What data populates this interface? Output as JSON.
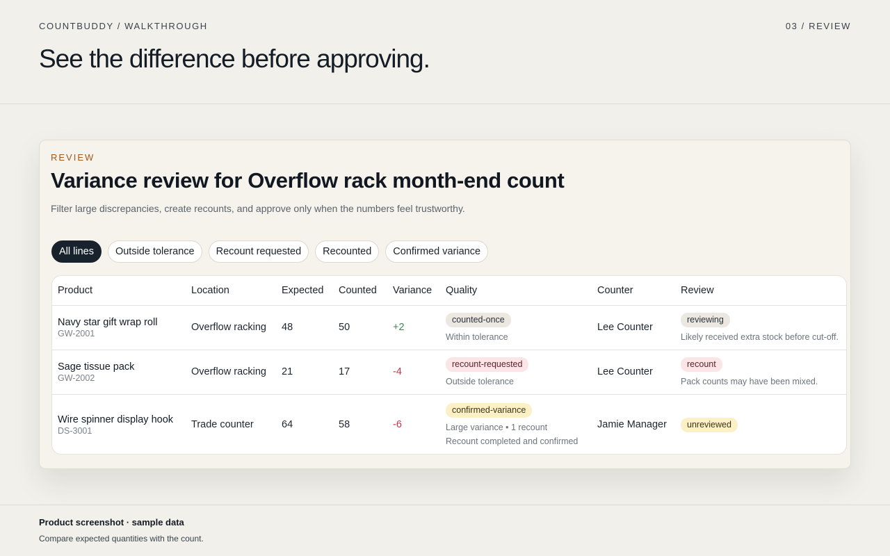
{
  "header": {
    "brand": "COUNTBUDDY / WALKTHROUGH",
    "step": "03 / REVIEW",
    "headline": "See the difference before approving."
  },
  "card": {
    "eyebrow": "REVIEW",
    "title": "Variance review for Overflow rack month-end count",
    "subtitle": "Filter large discrepancies, create recounts, and approve only when the numbers feel trustworthy."
  },
  "filters": [
    "All lines",
    "Outside tolerance",
    "Recount requested",
    "Recounted",
    "Confirmed variance"
  ],
  "table": {
    "columns": [
      "Product",
      "Location",
      "Expected",
      "Counted",
      "Variance",
      "Quality",
      "Counter",
      "Review"
    ],
    "rows": [
      {
        "product": "Navy star gift wrap roll",
        "sku": "GW-2001",
        "location": "Overflow racking",
        "expected": "48",
        "counted": "50",
        "variance": "+2",
        "quality_badge": "counted-once",
        "quality_note": "Within tolerance",
        "counter": "Lee Counter",
        "review_badge": "reviewing",
        "review_note": "Likely received extra stock before cut-off."
      },
      {
        "product": "Sage tissue pack",
        "sku": "GW-2002",
        "location": "Overflow racking",
        "expected": "21",
        "counted": "17",
        "variance": "-4",
        "quality_badge": "recount-requested",
        "quality_note": "Outside tolerance",
        "counter": "Lee Counter",
        "review_badge": "recount",
        "review_note": "Pack counts may have been mixed."
      },
      {
        "product": "Wire spinner display hook",
        "sku": "DS-3001",
        "location": "Trade counter",
        "expected": "64",
        "counted": "58",
        "variance": "-6",
        "quality_badge": "confirmed-variance",
        "quality_note": "Large variance • 1 recount",
        "quality_note2": "Recount completed and confirmed",
        "counter": "Jamie Manager",
        "review_badge": "unreviewed"
      }
    ]
  },
  "footer": {
    "title": "Product screenshot · sample data",
    "text": "Compare expected quantities with the count."
  },
  "colors": {
    "background": "#f1f0eb",
    "accent_eyebrow": "#a0561c",
    "active_chip": "#17222d",
    "positive": "#3f8a55",
    "negative": "#c0374a"
  }
}
